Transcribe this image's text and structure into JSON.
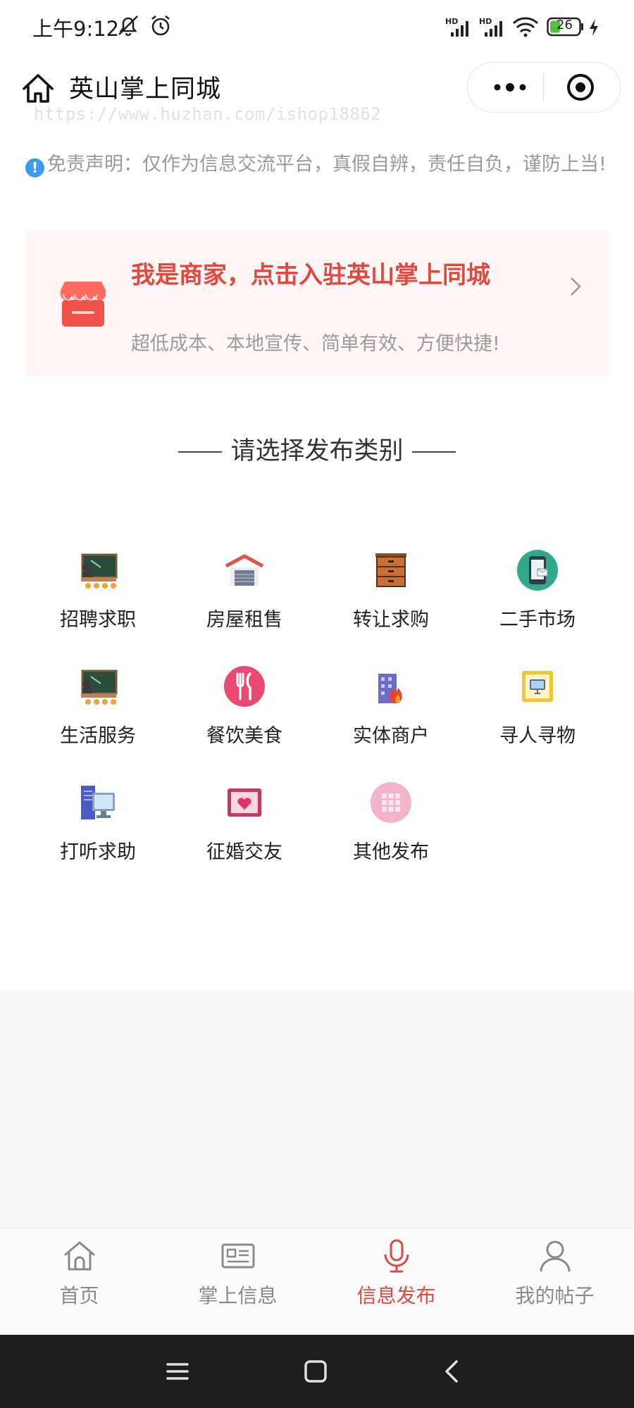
{
  "status_bar": {
    "time": "上午9:12",
    "battery": "26",
    "signal_1": "HD",
    "signal_2": "HD"
  },
  "header": {
    "title": "英山掌上同城",
    "watermark": "https://www.huzhan.com/ishop18862"
  },
  "disclaimer": {
    "text": "免责声明：仅作为信息交流平台，真假自辨，责任自负，谨防上当!"
  },
  "merchant_banner": {
    "title": "我是商家，点击入驻英山掌上同城",
    "subtitle": "超低成本、本地宣传、简单有效、方便快捷!"
  },
  "section": {
    "title": "请选择发布类别"
  },
  "categories": [
    {
      "label": "招聘求职",
      "icon": "classroom-icon"
    },
    {
      "label": "房屋租售",
      "icon": "garage-icon"
    },
    {
      "label": "转让求购",
      "icon": "drawer-icon"
    },
    {
      "label": "二手市场",
      "icon": "phone-icon"
    },
    {
      "label": "生活服务",
      "icon": "classroom-icon"
    },
    {
      "label": "餐饮美食",
      "icon": "fork-knife-icon"
    },
    {
      "label": "实体商户",
      "icon": "building-fire-icon"
    },
    {
      "label": "寻人寻物",
      "icon": "monitor-icon"
    },
    {
      "label": "打听求助",
      "icon": "computer-icon"
    },
    {
      "label": "征婚交友",
      "icon": "heart-frame-icon"
    },
    {
      "label": "其他发布",
      "icon": "grid-icon"
    }
  ],
  "tabbar": {
    "tabs": [
      {
        "label": "首页",
        "icon": "home-icon",
        "active": false
      },
      {
        "label": "掌上信息",
        "icon": "news-icon",
        "active": false
      },
      {
        "label": "信息发布",
        "icon": "microphone-icon",
        "active": true
      },
      {
        "label": "我的帖子",
        "icon": "user-icon",
        "active": false
      }
    ]
  },
  "colors": {
    "accent": "#e1483f",
    "banner_bg": "#fff6f5",
    "info_blue": "#3a9bf2"
  }
}
